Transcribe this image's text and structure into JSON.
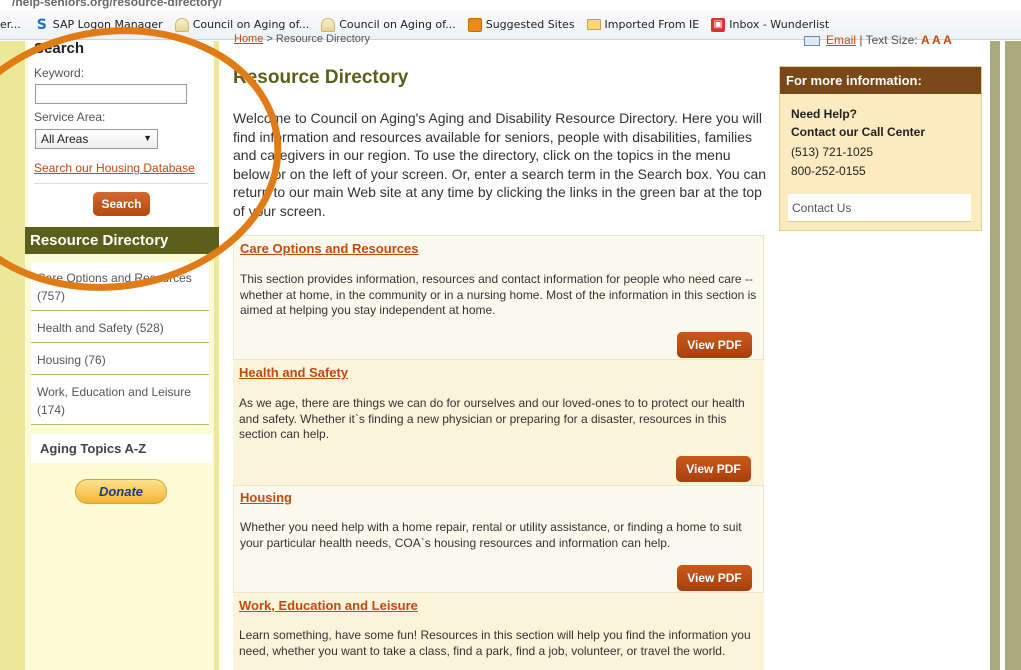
{
  "browser": {
    "address_text": "/help-seniors.org/resource-directory/",
    "favorites": [
      {
        "label": "er...",
        "icon": "none"
      },
      {
        "label": "SAP Logon Manager",
        "icon": "sap-icon"
      },
      {
        "label": "Council on Aging of...",
        "icon": "coa-icon"
      },
      {
        "label": "Council on Aging of...",
        "icon": "coa-icon"
      },
      {
        "label": "Suggested Sites",
        "icon": "suggested-sites-icon"
      },
      {
        "label": "Imported From IE",
        "icon": "folder-icon"
      },
      {
        "label": "Inbox - Wunderlist",
        "icon": "wunderlist-icon"
      }
    ]
  },
  "header": {
    "breadcrumb_home": "Home",
    "breadcrumb_sep": " > ",
    "breadcrumb_current": "Resource Directory",
    "email_label": "Email",
    "text_size_label": " | Text Size: ",
    "text_size_options": "A A A"
  },
  "left": {
    "search_title": "Search",
    "keyword_label": "Keyword:",
    "keyword_value": "",
    "service_area_label": "Service Area:",
    "service_area_value": "All Areas",
    "housing_link": "Search our Housing Database",
    "search_button": "Search",
    "directory_title": "Resource Directory",
    "directory_items": [
      {
        "label": "Care Options and Resources (757)"
      },
      {
        "label": "Health and Safety (528)"
      },
      {
        "label": "Housing (76)"
      },
      {
        "label": "Work, Education and Leisure (174)"
      }
    ],
    "aging_topics": "Aging Topics A-Z",
    "donate_button": "Donate"
  },
  "main": {
    "title": "Resource Directory",
    "intro": "Welcome to Council on Aging's Aging and Disability Resource Directory. Here you will find information and resources available for seniors, people with disabilities, families and caregivers in our region. To use the directory, click on the topics in the menu below or on the left of your screen. Or, enter a search term in the Search box. You can return to our main Web site at any time by clicking the links in the green bar at the top of your screen.",
    "sections": [
      {
        "title": "Care Options and Resources",
        "body": "This section provides information, resources and contact information for people who need care -- whether at home, in the community or in a nursing home. Most of the information in this section is aimed at helping you stay independent at home.",
        "button": "View PDF"
      },
      {
        "title": "Health and Safety",
        "body": "As we age, there are things we can do for ourselves and our loved-ones to to protect our health and safety. Whether it`s finding a new physician or preparing for a disaster, resources in this section can help.",
        "button": "View PDF"
      },
      {
        "title": "Housing",
        "body": "Whether you need help with a home repair, rental or utility assistance, or finding a home to suit your particular health needs, COA`s housing resources and information can help.",
        "button": "View PDF"
      },
      {
        "title": "Work, Education and Leisure",
        "body": "Learn something, have some fun! Resources in this section will help you find the information you need, whether you want to take a class, find a park, find a job, volunteer, or travel the world.",
        "button": ""
      }
    ]
  },
  "right": {
    "info_title": "For more information:",
    "need_help": "Need Help?",
    "call_center": "Contact our Call Center",
    "phone1": "(513) 721-1025",
    "phone2": "800-252-0155",
    "contact_us": "Contact Us"
  },
  "colors": {
    "accent_orange": "#c04a10",
    "olive": "#5b5f1c",
    "brown_header": "#7a4718",
    "annotation_circle": "#e07b16"
  }
}
